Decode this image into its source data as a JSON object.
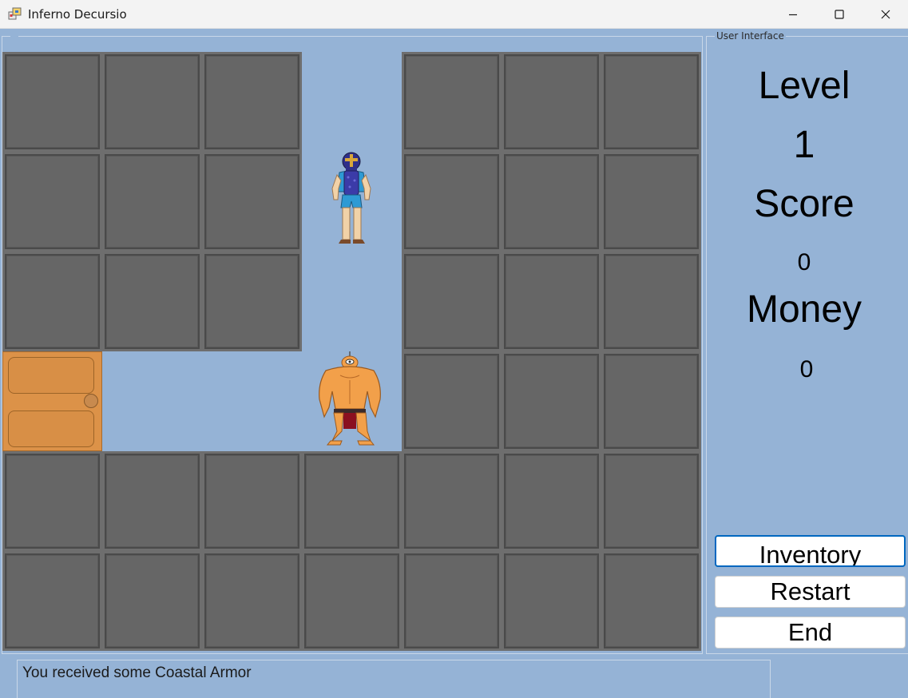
{
  "window": {
    "title": "Inferno Decursio"
  },
  "ui_panel": {
    "group_title": "User Interface",
    "level_label": "Level",
    "level_value": "1",
    "score_label": "Score",
    "score_value": "0",
    "money_label": "Money",
    "money_value": "0",
    "buttons": {
      "inventory": "Inventory",
      "restart": "Restart",
      "end": "End"
    }
  },
  "message": {
    "text": "You received some Coastal Armor"
  },
  "board": {
    "cell_types": [
      [
        "wall",
        "wall",
        "wall",
        "floor",
        "wall",
        "wall",
        "wall"
      ],
      [
        "wall",
        "wall",
        "wall",
        "player",
        "wall",
        "wall",
        "wall"
      ],
      [
        "wall",
        "wall",
        "wall",
        "floor",
        "wall",
        "wall",
        "wall"
      ],
      [
        "door",
        "floor",
        "floor",
        "enemy",
        "wall",
        "wall",
        "wall"
      ],
      [
        "wall",
        "wall",
        "wall",
        "wall",
        "wall",
        "wall",
        "wall"
      ],
      [
        "wall",
        "wall",
        "wall",
        "wall",
        "wall",
        "wall",
        "wall"
      ]
    ],
    "icons": {
      "player": "armored-hero-icon",
      "enemy": "muscular-cyclops-icon",
      "door": "door-icon"
    }
  },
  "colors": {
    "background": "#95b3d6",
    "wall": "#666666",
    "door": "#dc9248",
    "focus": "#0067c0"
  }
}
